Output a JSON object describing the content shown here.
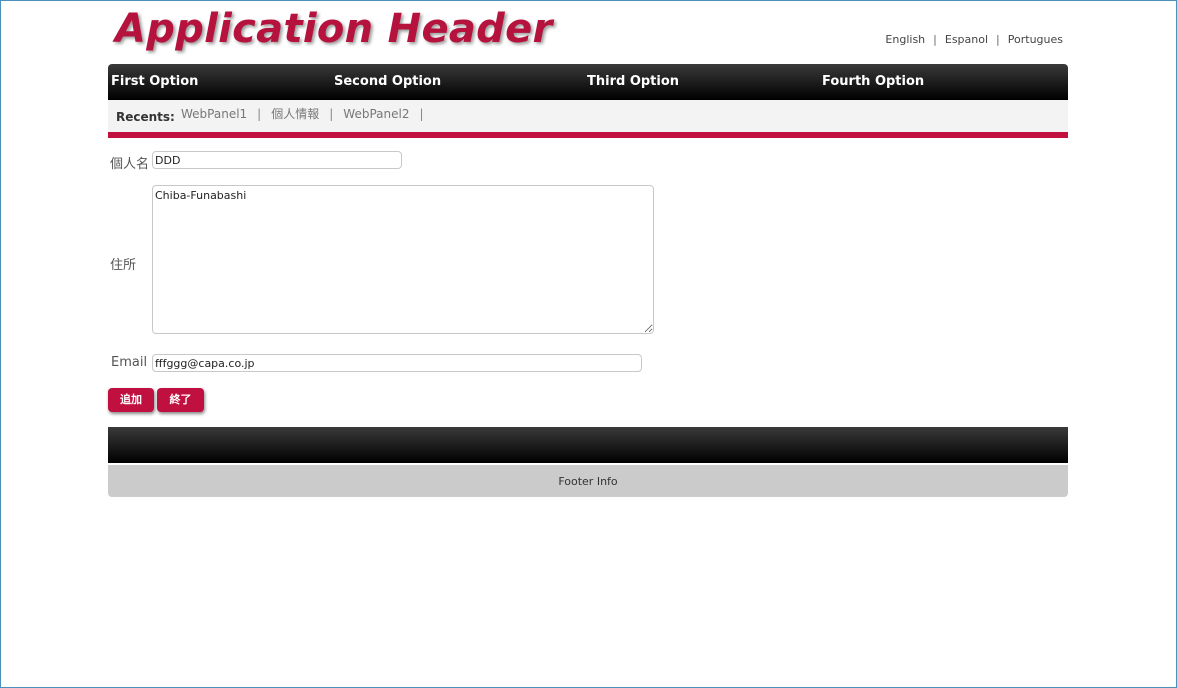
{
  "header": {
    "title": "Application Header",
    "languages": [
      "English",
      "Espanol",
      "Portugues"
    ]
  },
  "menu": {
    "items": [
      "First Option",
      "Second Option",
      "Third Option",
      "Fourth Option"
    ]
  },
  "recents": {
    "label": "Recents:",
    "links": [
      "WebPanel1",
      "個人情報",
      "WebPanel2"
    ],
    "separator": "|"
  },
  "form": {
    "name_label": "個人名",
    "name_value": "DDD",
    "address_label": "住所",
    "address_value": "Chiba-Funabashi",
    "email_label": "Email",
    "email_value": "fffggg@capa.co.jp"
  },
  "buttons": {
    "add_label": "追加",
    "close_label": "終了"
  },
  "footer": {
    "info": "Footer Info"
  },
  "colors": {
    "accent": "#c0113f",
    "menubar_top": "#3a3a3a",
    "menubar_bottom": "#000000",
    "recents_bg": "#f3f3f3",
    "footer_bg": "#cbcbcb"
  }
}
